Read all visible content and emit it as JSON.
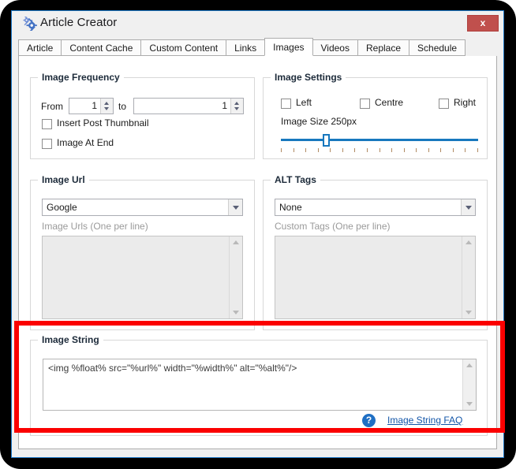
{
  "window": {
    "title": "Article Creator",
    "gear_icon": "gear-icon",
    "close_label": "x"
  },
  "tabs": [
    {
      "label": "Article",
      "active": false
    },
    {
      "label": "Content Cache",
      "active": false
    },
    {
      "label": "Custom Content",
      "active": false
    },
    {
      "label": "Links",
      "active": false
    },
    {
      "label": "Images",
      "active": true
    },
    {
      "label": "Videos",
      "active": false
    },
    {
      "label": "Replace",
      "active": false
    },
    {
      "label": "Schedule",
      "active": false
    }
  ],
  "image_frequency": {
    "title": "Image Frequency",
    "from_label": "From",
    "from_value": "1",
    "to_label": "to",
    "to_value": "1",
    "checkbox_thumbnail": "Insert Post Thumbnail",
    "checkbox_at_end": "Image At End"
  },
  "image_settings": {
    "title": "Image Settings",
    "align_left": "Left",
    "align_centre": "Centre",
    "align_right": "Right",
    "size_label": "Image Size 250px",
    "slider_value": 250,
    "slider_percent": 21,
    "tick_count": 17,
    "accent_color": "#1878be"
  },
  "image_url": {
    "title": "Image Url",
    "source_selected": "Google",
    "urls_label": "Image Urls (One per line)",
    "urls_value": ""
  },
  "alt_tags": {
    "title": "ALT Tags",
    "tag_selected": "None",
    "custom_label": "Custom Tags (One per line)",
    "custom_value": ""
  },
  "image_string": {
    "title": "Image String",
    "value": "<img %float% src=\"%url%\" width=\"%width%\" alt=\"%alt%\"/>",
    "help_icon": "?",
    "faq_link": "Image String FAQ"
  },
  "annotation": {
    "color": "#fb0000"
  }
}
